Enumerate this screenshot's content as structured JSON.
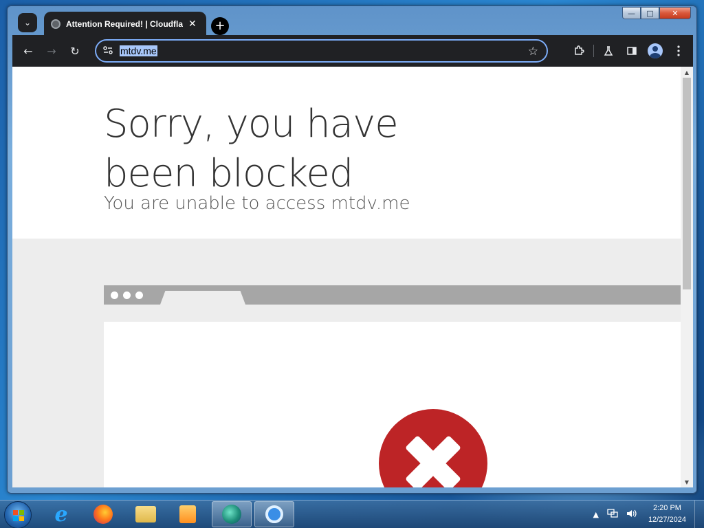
{
  "window": {
    "controls": {
      "minimize": "—",
      "maximize": "□",
      "close": "✕"
    }
  },
  "browser": {
    "tab": {
      "title": "Attention Required! | Cloudflare",
      "close": "✕",
      "icon": "globe-icon"
    },
    "tab_search_icon": "⌄",
    "new_tab": "+",
    "nav": {
      "back": "←",
      "forward": "→",
      "reload": "↻"
    },
    "omnibox": {
      "url": "mtdv.me",
      "site_info_icon": "tune-icon",
      "bookmark_icon": "☆"
    },
    "toolbar_icons": [
      "extensions-icon",
      "labs-icon",
      "side-panel-icon",
      "profile-icon",
      "menu-icon"
    ]
  },
  "page": {
    "headline": "Sorry, you have been blocked",
    "subline": "You are unable to access mtdv.me"
  },
  "taskbar": {
    "apps": [
      "internet-explorer",
      "firefox",
      "file-explorer",
      "media-player",
      "edge-browser",
      "search-app"
    ],
    "clock": {
      "time": "2:20 PM",
      "date": "12/27/2024"
    }
  },
  "colors": {
    "chrome_dark": "#202124",
    "focus_ring": "#7cacf8",
    "error_red": "#bd2426",
    "gray_zone": "#ededed"
  }
}
